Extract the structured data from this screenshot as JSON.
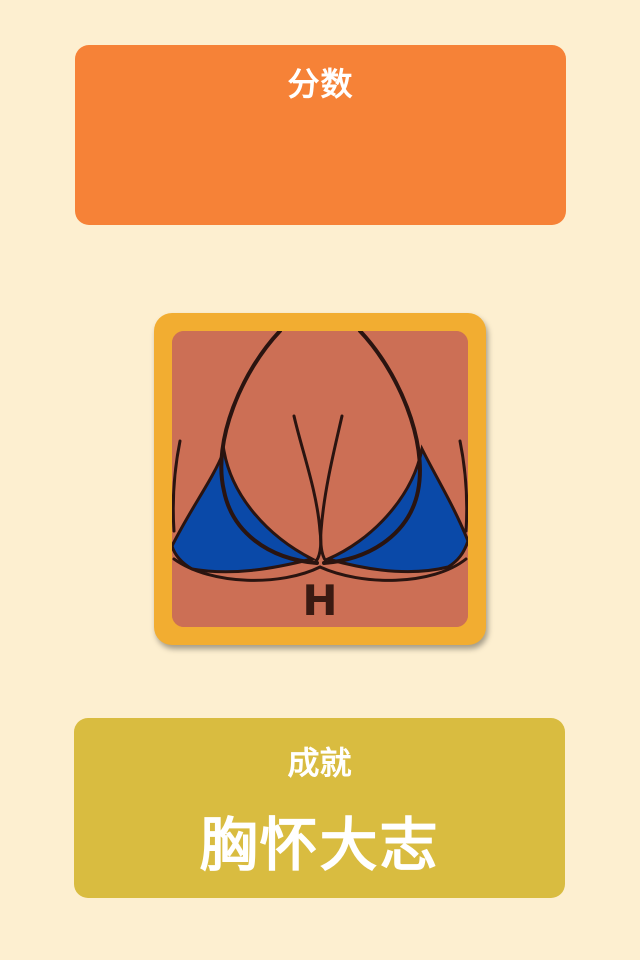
{
  "score": {
    "title": "分数",
    "value": ""
  },
  "card": {
    "cup_letter": "H",
    "colors": {
      "frame": "#f2ad31",
      "skin": "#cc6f55",
      "bikini": "#0a49a8",
      "outline": "#2a1410"
    }
  },
  "achievement": {
    "title": "成就",
    "name": "胸怀大志"
  },
  "colors": {
    "background": "#fdefd0",
    "score_panel": "#f68237",
    "achievement_panel": "#d9bc40"
  }
}
